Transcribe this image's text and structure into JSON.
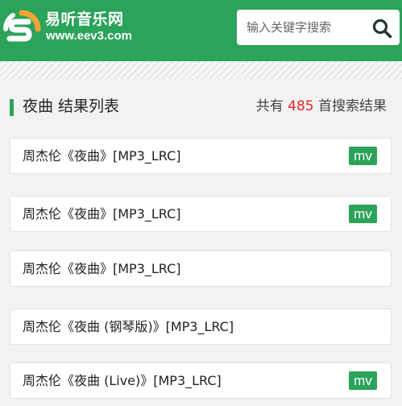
{
  "header": {
    "site_name": "易听音乐网",
    "site_url": "www.eev3.com",
    "search_placeholder": "输入关键字搜索",
    "colors": {
      "brand": "#2ba35a",
      "logo_orange": "#f2a533"
    }
  },
  "results": {
    "heading": "夜曲 结果列表",
    "count_prefix": "共有 ",
    "count": "485",
    "count_suffix": " 首搜索结果",
    "count_color": "#e8242b",
    "songs": [
      {
        "title": "周杰伦《夜曲》[MP3_LRC]",
        "badge": "mv"
      },
      {
        "title": "周杰伦《夜曲》[MP3_LRC]",
        "badge": "mv"
      },
      {
        "title": "周杰伦《夜曲》[MP3_LRC]",
        "badge": ""
      },
      {
        "title": "周杰伦《夜曲 (钢琴版)》[MP3_LRC]",
        "badge": ""
      },
      {
        "title": "周杰伦《夜曲 (Live)》[MP3_LRC]",
        "badge": "mv"
      }
    ]
  }
}
